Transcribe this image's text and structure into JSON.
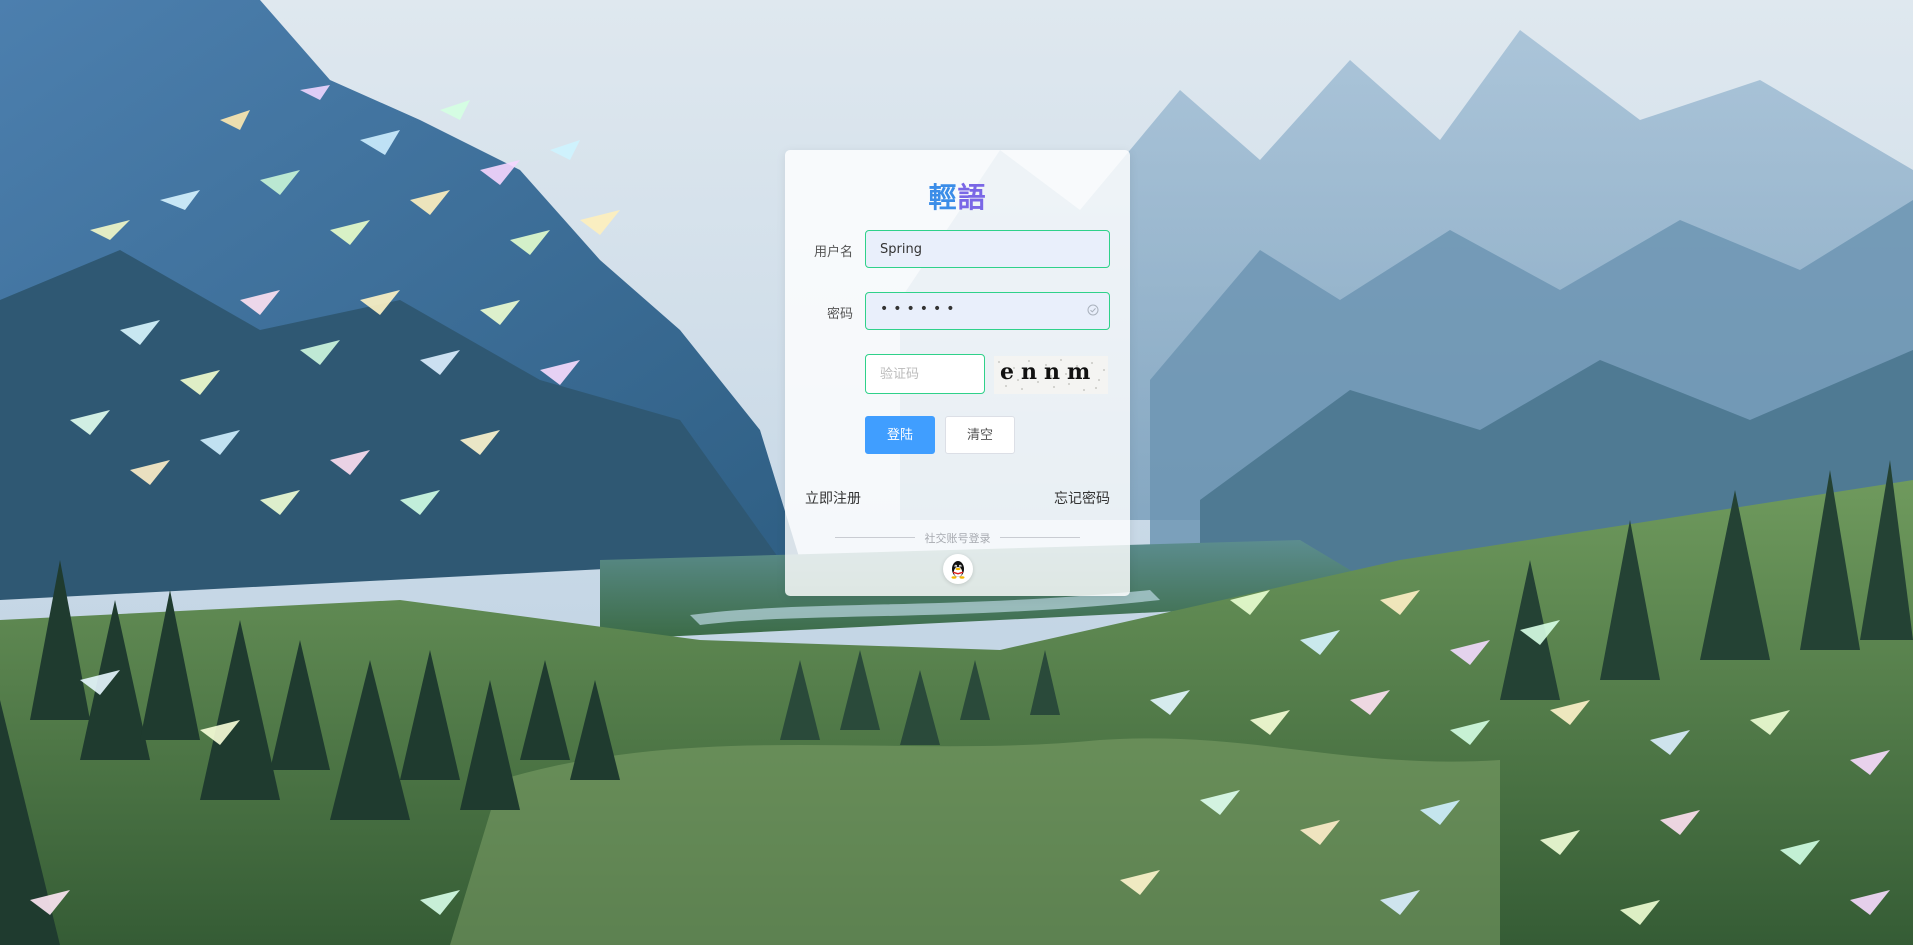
{
  "brand": {
    "part1": "輕",
    "part2": "語"
  },
  "login_form": {
    "username_label": "用户名",
    "username_value": "Spring",
    "password_label": "密码",
    "password_masked": "••••••",
    "captcha_placeholder": "验证码",
    "captcha_image_text": "ennm",
    "login_button": "登陆",
    "clear_button": "清空"
  },
  "links": {
    "register": "立即注册",
    "forgot_password": "忘记密码"
  },
  "social": {
    "divider_text": "社交账号登录",
    "providers": [
      "qq-icon"
    ]
  },
  "colors": {
    "primary": "#409eff",
    "focus_border": "#2fd18a",
    "brand_blue": "#3b8de8",
    "brand_purple": "#7a67e6"
  }
}
